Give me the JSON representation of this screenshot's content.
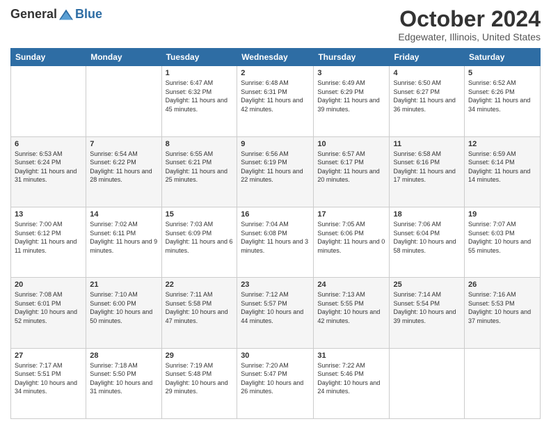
{
  "header": {
    "logo_general": "General",
    "logo_blue": "Blue",
    "month_title": "October 2024",
    "location": "Edgewater, Illinois, United States"
  },
  "weekdays": [
    "Sunday",
    "Monday",
    "Tuesday",
    "Wednesday",
    "Thursday",
    "Friday",
    "Saturday"
  ],
  "weeks": [
    [
      null,
      null,
      {
        "day": 1,
        "sunrise": "6:47 AM",
        "sunset": "6:32 PM",
        "daylight": "11 hours and 45 minutes."
      },
      {
        "day": 2,
        "sunrise": "6:48 AM",
        "sunset": "6:31 PM",
        "daylight": "11 hours and 42 minutes."
      },
      {
        "day": 3,
        "sunrise": "6:49 AM",
        "sunset": "6:29 PM",
        "daylight": "11 hours and 39 minutes."
      },
      {
        "day": 4,
        "sunrise": "6:50 AM",
        "sunset": "6:27 PM",
        "daylight": "11 hours and 36 minutes."
      },
      {
        "day": 5,
        "sunrise": "6:52 AM",
        "sunset": "6:26 PM",
        "daylight": "11 hours and 34 minutes."
      }
    ],
    [
      {
        "day": 6,
        "sunrise": "6:53 AM",
        "sunset": "6:24 PM",
        "daylight": "11 hours and 31 minutes."
      },
      {
        "day": 7,
        "sunrise": "6:54 AM",
        "sunset": "6:22 PM",
        "daylight": "11 hours and 28 minutes."
      },
      {
        "day": 8,
        "sunrise": "6:55 AM",
        "sunset": "6:21 PM",
        "daylight": "11 hours and 25 minutes."
      },
      {
        "day": 9,
        "sunrise": "6:56 AM",
        "sunset": "6:19 PM",
        "daylight": "11 hours and 22 minutes."
      },
      {
        "day": 10,
        "sunrise": "6:57 AM",
        "sunset": "6:17 PM",
        "daylight": "11 hours and 20 minutes."
      },
      {
        "day": 11,
        "sunrise": "6:58 AM",
        "sunset": "6:16 PM",
        "daylight": "11 hours and 17 minutes."
      },
      {
        "day": 12,
        "sunrise": "6:59 AM",
        "sunset": "6:14 PM",
        "daylight": "11 hours and 14 minutes."
      }
    ],
    [
      {
        "day": 13,
        "sunrise": "7:00 AM",
        "sunset": "6:12 PM",
        "daylight": "11 hours and 11 minutes."
      },
      {
        "day": 14,
        "sunrise": "7:02 AM",
        "sunset": "6:11 PM",
        "daylight": "11 hours and 9 minutes."
      },
      {
        "day": 15,
        "sunrise": "7:03 AM",
        "sunset": "6:09 PM",
        "daylight": "11 hours and 6 minutes."
      },
      {
        "day": 16,
        "sunrise": "7:04 AM",
        "sunset": "6:08 PM",
        "daylight": "11 hours and 3 minutes."
      },
      {
        "day": 17,
        "sunrise": "7:05 AM",
        "sunset": "6:06 PM",
        "daylight": "11 hours and 0 minutes."
      },
      {
        "day": 18,
        "sunrise": "7:06 AM",
        "sunset": "6:04 PM",
        "daylight": "10 hours and 58 minutes."
      },
      {
        "day": 19,
        "sunrise": "7:07 AM",
        "sunset": "6:03 PM",
        "daylight": "10 hours and 55 minutes."
      }
    ],
    [
      {
        "day": 20,
        "sunrise": "7:08 AM",
        "sunset": "6:01 PM",
        "daylight": "10 hours and 52 minutes."
      },
      {
        "day": 21,
        "sunrise": "7:10 AM",
        "sunset": "6:00 PM",
        "daylight": "10 hours and 50 minutes."
      },
      {
        "day": 22,
        "sunrise": "7:11 AM",
        "sunset": "5:58 PM",
        "daylight": "10 hours and 47 minutes."
      },
      {
        "day": 23,
        "sunrise": "7:12 AM",
        "sunset": "5:57 PM",
        "daylight": "10 hours and 44 minutes."
      },
      {
        "day": 24,
        "sunrise": "7:13 AM",
        "sunset": "5:55 PM",
        "daylight": "10 hours and 42 minutes."
      },
      {
        "day": 25,
        "sunrise": "7:14 AM",
        "sunset": "5:54 PM",
        "daylight": "10 hours and 39 minutes."
      },
      {
        "day": 26,
        "sunrise": "7:16 AM",
        "sunset": "5:53 PM",
        "daylight": "10 hours and 37 minutes."
      }
    ],
    [
      {
        "day": 27,
        "sunrise": "7:17 AM",
        "sunset": "5:51 PM",
        "daylight": "10 hours and 34 minutes."
      },
      {
        "day": 28,
        "sunrise": "7:18 AM",
        "sunset": "5:50 PM",
        "daylight": "10 hours and 31 minutes."
      },
      {
        "day": 29,
        "sunrise": "7:19 AM",
        "sunset": "5:48 PM",
        "daylight": "10 hours and 29 minutes."
      },
      {
        "day": 30,
        "sunrise": "7:20 AM",
        "sunset": "5:47 PM",
        "daylight": "10 hours and 26 minutes."
      },
      {
        "day": 31,
        "sunrise": "7:22 AM",
        "sunset": "5:46 PM",
        "daylight": "10 hours and 24 minutes."
      },
      null,
      null
    ]
  ]
}
